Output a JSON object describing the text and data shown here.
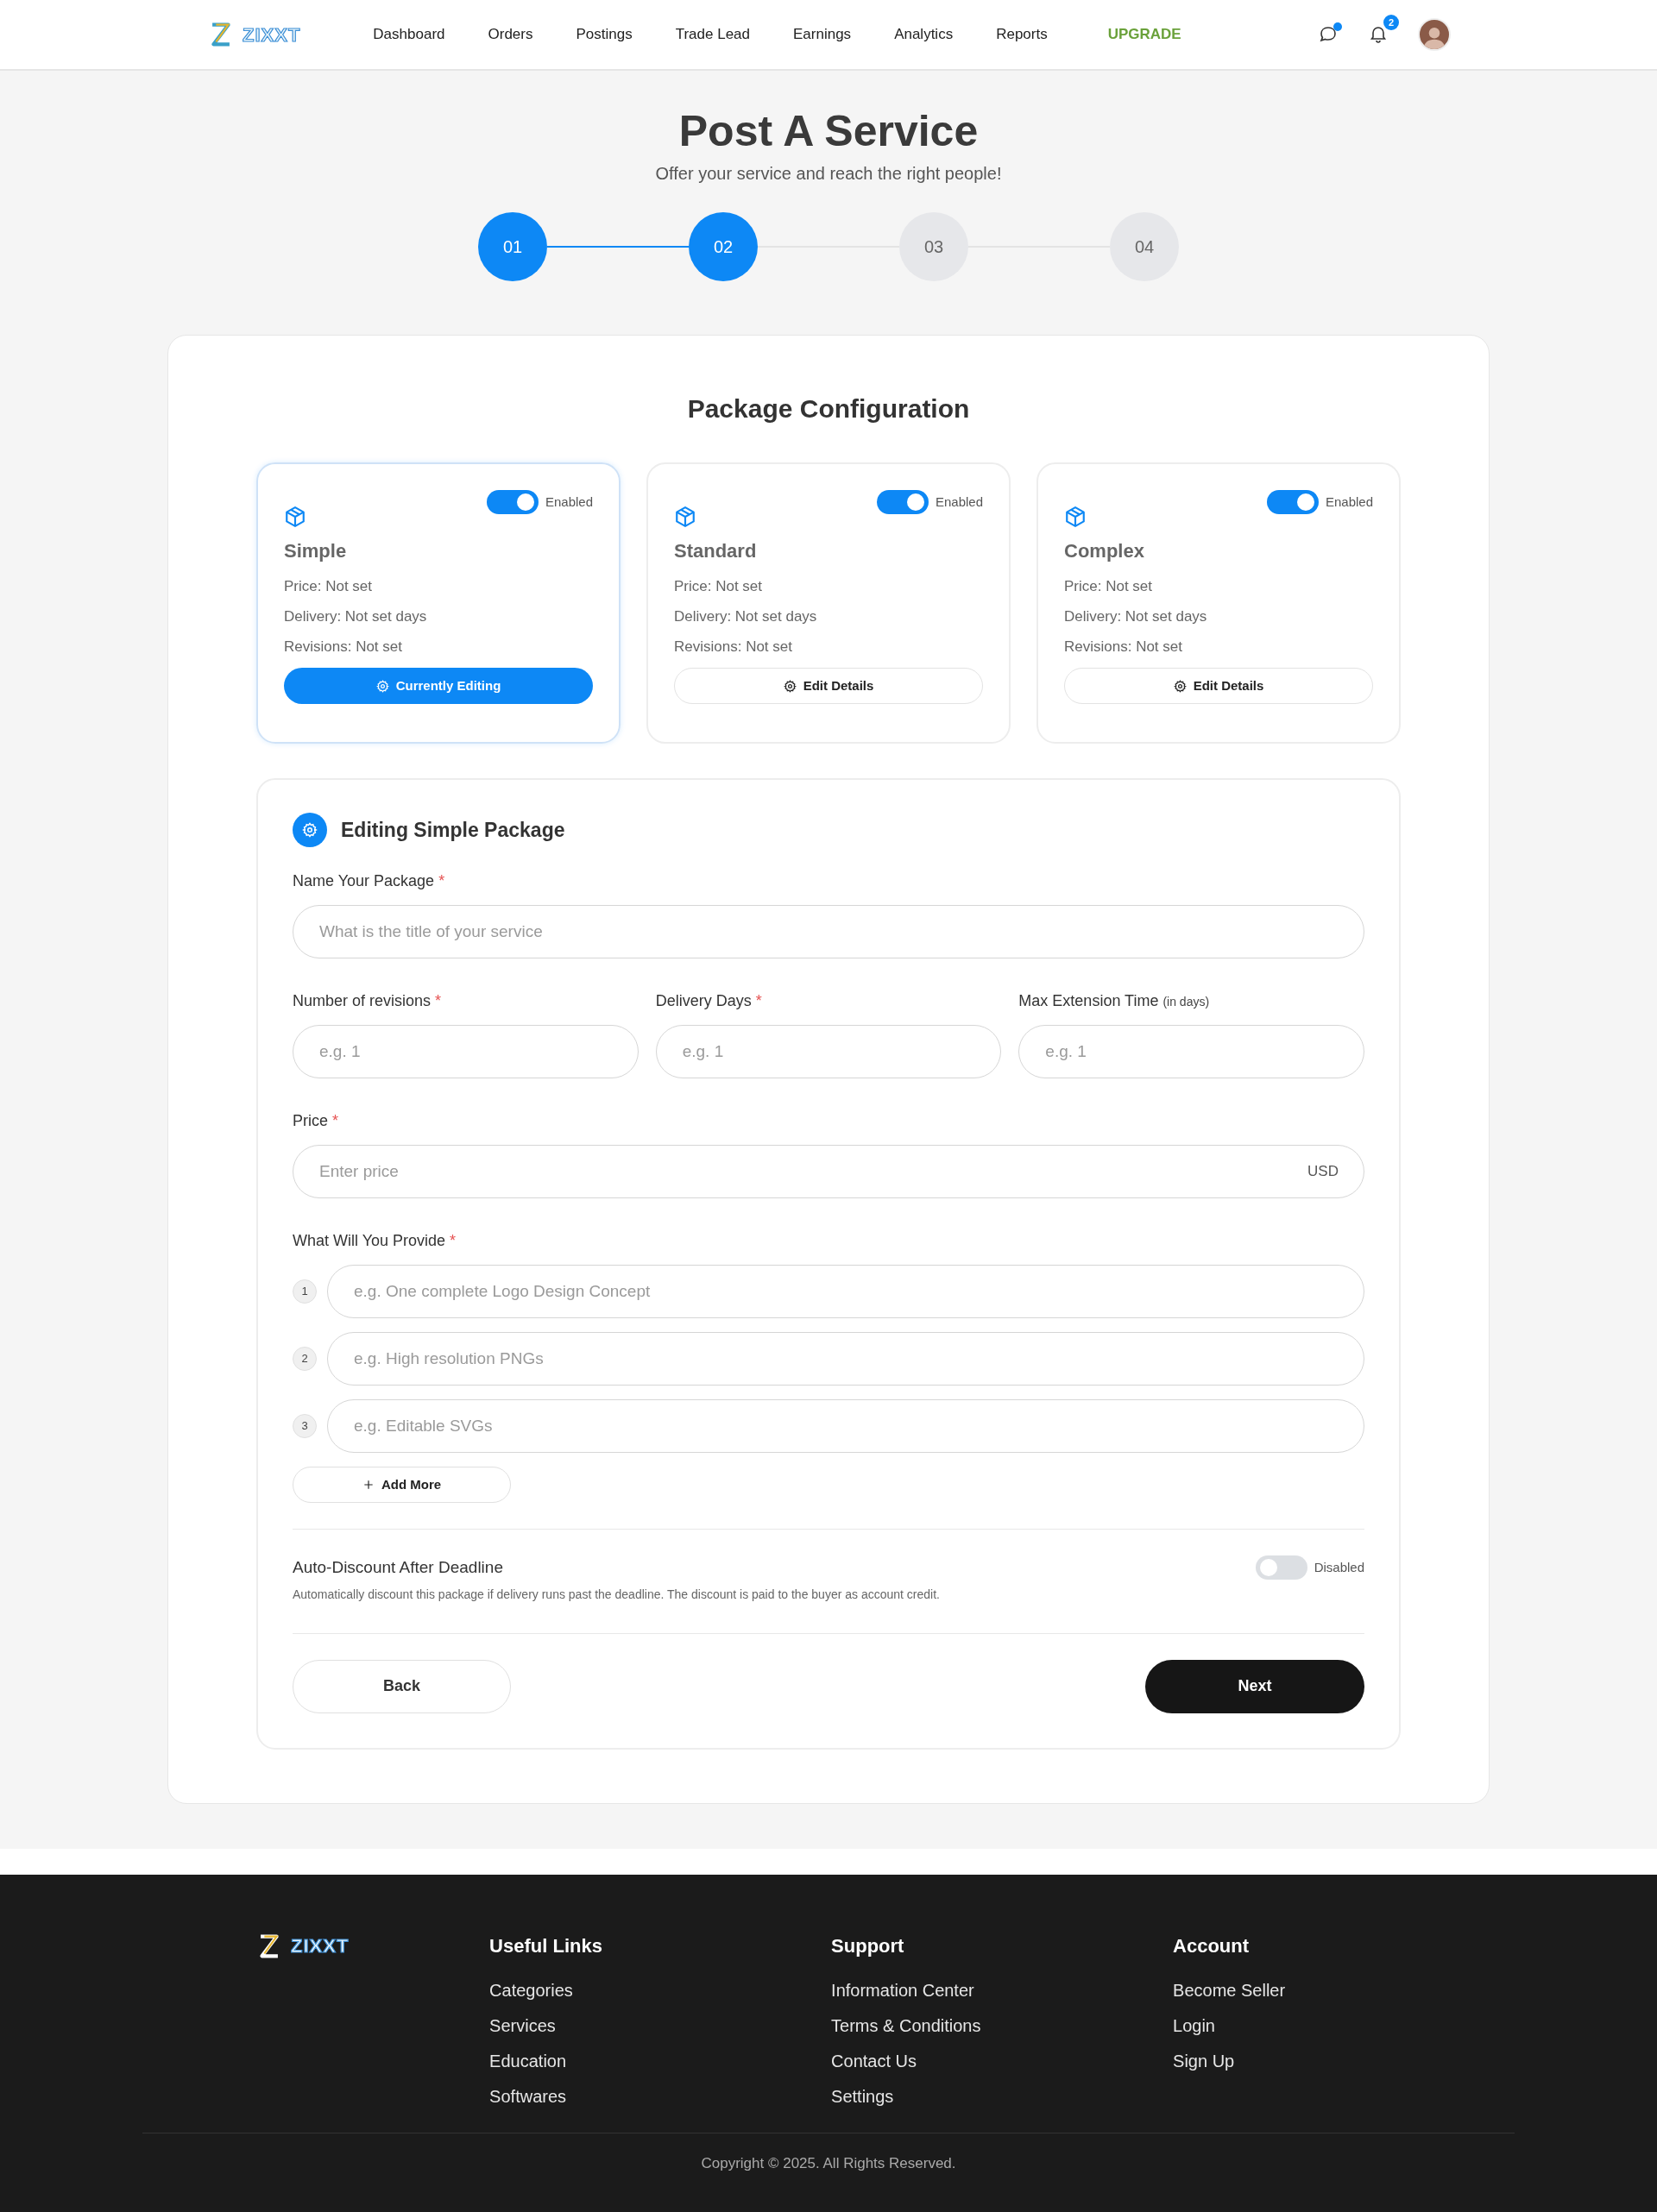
{
  "nav": {
    "logo": "ZIXXT",
    "links": [
      {
        "label": "Dashboard",
        "kind": "link"
      },
      {
        "label": "Orders",
        "kind": "link"
      },
      {
        "label": "Postings",
        "kind": "link"
      },
      {
        "label": "Trade Lead",
        "kind": "link"
      },
      {
        "label": "Earnings",
        "kind": "link"
      },
      {
        "label": "Analytics",
        "kind": "link"
      },
      {
        "label": "Reports",
        "kind": "link"
      },
      {
        "label": "UPGRADE",
        "kind": "upgrade"
      }
    ],
    "messages_unread": true,
    "notification_count": "2"
  },
  "header": {
    "title": "Post A Service",
    "subtitle": "Offer your service and reach the right people!"
  },
  "steps": [
    {
      "label": "01",
      "active": true
    },
    {
      "label": "02",
      "active": true
    },
    {
      "label": "03",
      "active": false
    },
    {
      "label": "04",
      "active": false
    }
  ],
  "section_title": "Package Configuration",
  "packages": [
    {
      "name": "Simple",
      "enabled": true,
      "status": "Enabled",
      "price": "Price: Not set",
      "delivery": "Delivery: Not set days",
      "revisions": "Revisions: Not set",
      "selected": true,
      "button": "Currently Editing"
    },
    {
      "name": "Standard",
      "enabled": true,
      "status": "Enabled",
      "price": "Price: Not set",
      "delivery": "Delivery: Not set days",
      "revisions": "Revisions: Not set",
      "selected": false,
      "button": "Edit Details"
    },
    {
      "name": "Complex",
      "enabled": true,
      "status": "Enabled",
      "price": "Price: Not set",
      "delivery": "Delivery: Not set days",
      "revisions": "Revisions: Not set",
      "selected": false,
      "button": "Edit Details"
    }
  ],
  "editor": {
    "title": "Editing Simple Package",
    "name_field": {
      "label": "Name Your Package",
      "required_mark": "*",
      "placeholder": "What is the title of your service"
    },
    "small_fields": [
      {
        "label": "Number of revisions",
        "required_mark": "*",
        "placeholder": "e.g. 1"
      },
      {
        "label": "Delivery Days",
        "required_mark": "*",
        "placeholder": "e.g. 1"
      },
      {
        "label": "Max Extension Time",
        "note": "(in days)",
        "placeholder": "e.g. 1"
      }
    ],
    "price_field": {
      "label": "Price",
      "required_mark": "*",
      "placeholder": "Enter price",
      "suffix": "USD"
    },
    "provide": {
      "label": "What Will You Provide",
      "required_mark": "*",
      "items": [
        {
          "number": "1",
          "placeholder": "e.g. One complete Logo Design Concept"
        },
        {
          "number": "2",
          "placeholder": "e.g. High resolution PNGs"
        },
        {
          "number": "3",
          "placeholder": "e.g. Editable SVGs"
        }
      ],
      "add_button": "Add More"
    },
    "auto_discount": {
      "title": "Auto-Discount After Deadline",
      "description": "Automatically discount this package if delivery runs past the deadline. The discount is paid to the buyer as account credit.",
      "on": false,
      "status": "Disabled"
    },
    "back_button": "Back",
    "next_button": "Next"
  },
  "footer": {
    "logo": "ZIXXT",
    "columns": [
      {
        "heading": "Useful Links",
        "links": [
          "Categories",
          "Services",
          "Education",
          "Softwares"
        ]
      },
      {
        "heading": "Support",
        "links": [
          "Information Center",
          "Terms & Conditions",
          "Contact Us",
          "Settings"
        ]
      },
      {
        "heading": "Account",
        "links": [
          "Become Seller",
          "Login",
          "Sign Up"
        ]
      }
    ],
    "copyright": "Copyright © 2025. All Rights Reserved."
  }
}
